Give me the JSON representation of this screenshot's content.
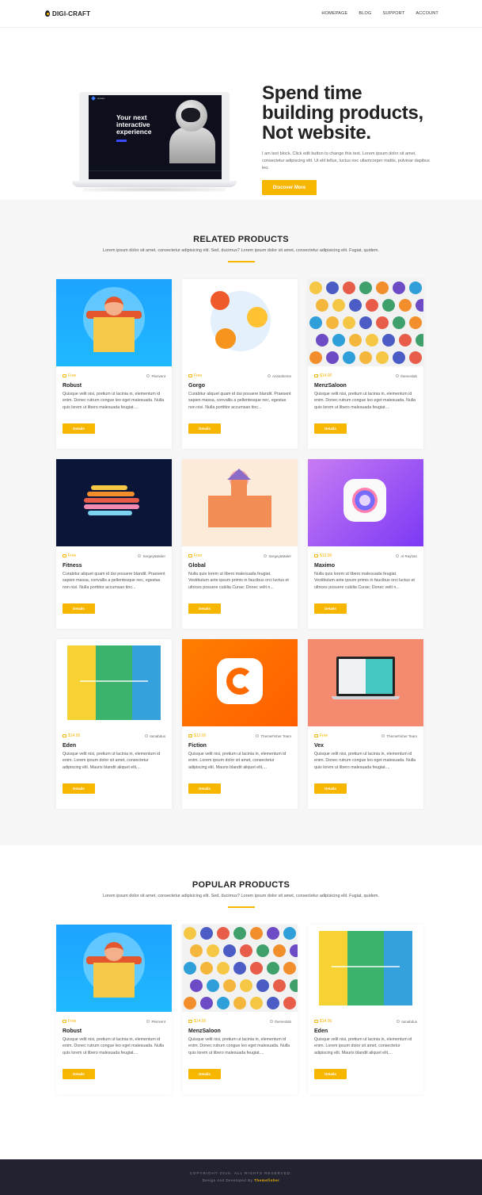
{
  "nav": {
    "brand": "DIGI-CRAFT",
    "links": [
      "HOMEPAGE",
      "BLOG",
      "SUPPORT",
      "ACCOUNT"
    ]
  },
  "hero": {
    "screen_brand": "sudora",
    "screen_title": "Your next interactive experience",
    "title_line1": "Spend time",
    "title_line2": "building products,",
    "title_line3": "Not website.",
    "description": "I am text block. Click edit button to change this text. Lorem ipsum dolor sit amet, consectetur adipiscing elit. Ut elit tellus, luctus nec ullamcorper mattis, pulvinar dapibus leo.",
    "button": "Discover More"
  },
  "related": {
    "title": "RELATED PRODUCTS",
    "subtitle": "Lorem ipsum dolor sit amet, consectetur adipisicing elit. Sed, ducimus? Lorem ipsum dolor sit amet, consectetur adipisicing elit. Fugiat, quidem.",
    "products": [
      {
        "price": "Free",
        "author": "Plerivent",
        "title": "Robust",
        "desc": "Quisque velit nisi, pretium ut lacinia in, elementum id enim. Donec rutrum congue leo eget malesuada. Nulla quis lorem ut libero malesuada feugiat....",
        "button": "Details",
        "art": "robust"
      },
      {
        "price": "Free",
        "author": "Aristotheme",
        "title": "Gorgo",
        "desc": "Curabitur aliquet quam id dui posuere blandit. Praesent sapien massa, convallis a pellentesque nec, egestas non nisi. Nulla porttitor accumsan tinc...",
        "button": "Details",
        "art": "gorgo"
      },
      {
        "price": "$14.00",
        "author": "themeslab",
        "title": "MenzSaloon",
        "desc": "Quisque velit nisi, pretium ut lacinia in, elementum id enim. Donec rutrum congue leo eget malesuada. Nulla quis lorem ut libero malesuada feugiat....",
        "button": "Details",
        "art": "menz"
      },
      {
        "price": "Free",
        "author": "Sergey&Maler",
        "title": "Fitness",
        "desc": "Curabitur aliquet quam id dui posuere blandit. Praesent sapien massa, convallis a pellentesque nec, egestas non nisi. Nulla porttitor accumsan tinc...",
        "button": "Details",
        "art": "fitness"
      },
      {
        "price": "Free",
        "author": "Sergey&Maler",
        "title": "Global",
        "desc": "Nulla quis lorem ut libero malesuada feugiat. Vestibulum ante ipsum primis in faucibus orci luctus et ultrices posuere cubilia Curae; Donec velit n...",
        "button": "Details",
        "art": "global"
      },
      {
        "price": "$12.00",
        "author": "Al Rayhan",
        "title": "Maximo",
        "desc": "Nulla quis lorem ut libero malesuada feugiat. Vestibulum ante ipsum primis in faucibus orci luctus et ultrices posuere cubilia Curae; Donec velit n...",
        "button": "Details",
        "art": "maximo"
      },
      {
        "price": "$14.00",
        "author": "Iamabdus",
        "title": "Eden",
        "desc": "Quisque velit nisi, pretium ut lacinia in, elementum id enim. Lorem ipsum dolor sit amet, consectetur adipiscing elit. Mauris blandit aliquet elit,...",
        "button": "Details",
        "art": "eden"
      },
      {
        "price": "$12.00",
        "author": "ThemeFisher Team",
        "title": "Fiction",
        "desc": "Quisque velit nisi, pretium ut lacinia in, elementum id enim. Lorem ipsum dolor sit amet, consectetur adipiscing elit. Mauris blandit aliquet elit,...",
        "button": "Details",
        "art": "fiction"
      },
      {
        "price": "Free",
        "author": "ThemeFisher Team",
        "title": "Vex",
        "desc": "Quisque velit nisi, pretium ut lacinia in, elementum id enim. Donec rutrum congue leo eget malesuada. Nulla quis lorem ut libero malesuada feugiat....",
        "button": "Details",
        "art": "vex"
      }
    ]
  },
  "popular": {
    "title": "POPULAR PRODUCTS",
    "subtitle": "Lorem ipsum dolor sit amet, consectetur adipisicing elit. Sed, ducimus? Lorem ipsum dolor sit amet, consectetur adipisicing elit. Fugiat, quidem.",
    "products": [
      {
        "price": "Free",
        "author": "Plerivent",
        "title": "Robust",
        "desc": "Quisque velit nisi, pretium ut lacinia in, elementum id enim. Donec rutrum congue leo eget malesuada. Nulla quis lorem ut libero malesuada feugiat....",
        "button": "Details",
        "art": "robust"
      },
      {
        "price": "$14.00",
        "author": "themeslab",
        "title": "MenzSaloon",
        "desc": "Quisque velit nisi, pretium ut lacinia in, elementum id enim. Donec rutrum congue leo eget malesuada. Nulla quis lorem ut libero malesuada feugiat....",
        "button": "Details",
        "art": "menz"
      },
      {
        "price": "$14.00",
        "author": "Iamabdus",
        "title": "Eden",
        "desc": "Quisque velit nisi, pretium ut lacinia in, elementum id enim. Lorem ipsum dolor sit amet, consectetur adipiscing elit. Mauris blandit aliquet elit,...",
        "button": "Details",
        "art": "eden"
      }
    ]
  },
  "footer": {
    "copyright": "COPYRIGHT 2016. ALL RIGHTS RESERVED.",
    "credit_prefix": "Design And Developed By",
    "credit_name": "Themefisher"
  },
  "colors": {
    "accent": "#f7b600",
    "footer_bg": "#222331",
    "section_bg": "#f7f7f7"
  }
}
